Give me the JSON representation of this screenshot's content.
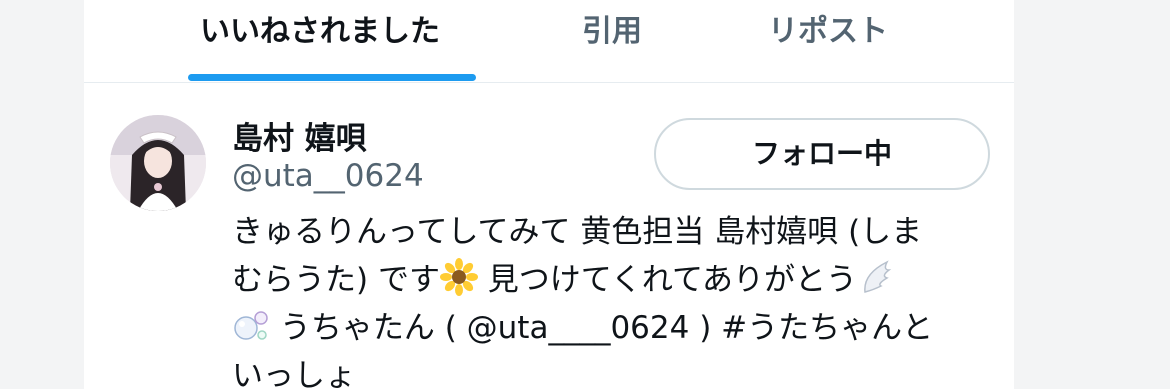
{
  "tabs": [
    {
      "label": "いいねされました",
      "active": true
    },
    {
      "label": "引用",
      "active": false
    },
    {
      "label": "リポスト",
      "active": false
    }
  ],
  "colors": {
    "accent": "#1d9bf0",
    "text": "#0f1419",
    "muted": "#536471",
    "border": "#cfd9de"
  },
  "user": {
    "name": "島村 嬉唄",
    "handle": "@uta__0624",
    "follow_label": "フォロー中",
    "bio": {
      "line1": "きゅるりんってしてみて 黄色担当 島村嬉唄 (しま",
      "line2a": "むらうた) です",
      "line2b": " 見つけてくれてありがとう",
      "line3a": " うちゃたん ( ",
      "line3_mention": "@uta____0624",
      "line3b": " ) ",
      "line3_hashtag": "#うたちゃんと",
      "line4": "いっしょ"
    },
    "icons": [
      "sunflower-emoji",
      "wing-emoji",
      "bubbles-emoji"
    ]
  }
}
